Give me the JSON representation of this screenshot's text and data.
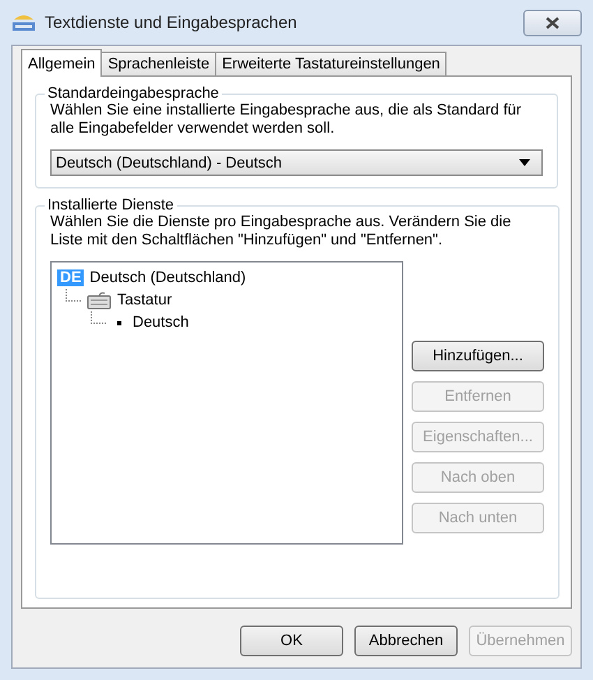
{
  "window": {
    "title": "Textdienste und Eingabesprachen"
  },
  "tabs": [
    {
      "label": "Allgemein",
      "selected": true
    },
    {
      "label": "Sprachenleiste",
      "selected": false
    },
    {
      "label": "Erweiterte Tastatureinstellungen",
      "selected": false
    }
  ],
  "default_language": {
    "title": "Standardeingabesprache",
    "description": "Wählen Sie eine installierte Eingabesprache aus, die als Standard für alle Eingabefelder verwendet werden soll.",
    "value": "Deutsch (Deutschland) - Deutsch"
  },
  "services": {
    "title": "Installierte Dienste",
    "description": "Wählen Sie die Dienste pro Eingabesprache aus. Verändern Sie die Liste mit den Schaltflächen \"Hinzufügen\" und \"Entfernen\".",
    "tree": [
      {
        "kind": "language",
        "badge": "DE",
        "label": "Deutsch (Deutschland)",
        "children": [
          {
            "kind": "category",
            "label": "Tastatur",
            "children": [
              {
                "kind": "service",
                "label": "Deutsch"
              }
            ]
          }
        ]
      }
    ],
    "buttons": [
      {
        "label": "Hinzufügen...",
        "disabled": false
      },
      {
        "label": "Entfernen",
        "disabled": true
      },
      {
        "label": "Eigenschaften...",
        "disabled": true
      },
      {
        "label": "Nach oben",
        "disabled": true
      },
      {
        "label": "Nach unten",
        "disabled": true
      }
    ]
  },
  "footer_buttons": [
    {
      "label": "OK",
      "disabled": false
    },
    {
      "label": "Abbrechen",
      "disabled": false
    },
    {
      "label": "Übernehmen",
      "disabled": true
    }
  ]
}
